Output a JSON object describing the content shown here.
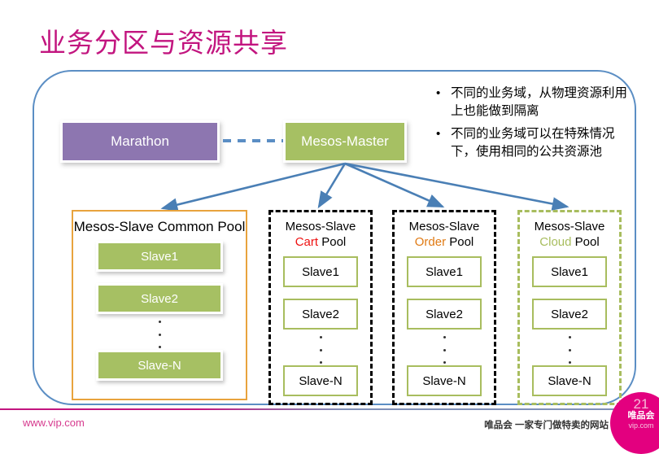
{
  "slide": {
    "title": "业务分区与资源共享"
  },
  "bullets": [
    {
      "marker": "•",
      "text": "不同的业务域，从物理资源利用上也能做到隔离"
    },
    {
      "marker": "•",
      "text": "不同的业务域可以在特殊情况下，使用相同的公共资源池"
    }
  ],
  "top_nodes": {
    "marathon": {
      "label": "Marathon",
      "color": "#8d76b0"
    },
    "mesos_master": {
      "label": "Mesos-Master",
      "color": "#a6c063"
    }
  },
  "pools": [
    {
      "id": "common",
      "title_line1": "Mesos-Slave Common",
      "title_line2": "Pool",
      "tag": "",
      "tag_color": "",
      "border_color": "#e8a33d",
      "border_style": "solid",
      "slave_style": "filled",
      "slaves": [
        "Slave1",
        "Slave2",
        "Slave-N"
      ]
    },
    {
      "id": "cart",
      "title_line1": "Mesos-Slave",
      "title_line2": "Pool",
      "tag": "Cart",
      "tag_color": "#ee1111",
      "border_color": "#000000",
      "border_style": "dashed",
      "slave_style": "outline",
      "slaves": [
        "Slave1",
        "Slave2",
        "Slave-N"
      ]
    },
    {
      "id": "order",
      "title_line1": "Mesos-Slave",
      "title_line2": "Pool",
      "tag": "Order",
      "tag_color": "#e07a14",
      "border_color": "#000000",
      "border_style": "dashed",
      "slave_style": "outline",
      "slaves": [
        "Slave1",
        "Slave2",
        "Slave-N"
      ]
    },
    {
      "id": "cloud",
      "title_line1": "Mesos-Slave",
      "title_line2": "Pool",
      "tag": "Cloud",
      "tag_color": "#a8bd5e",
      "border_color": "#a8bd5e",
      "border_style": "dashed",
      "slave_style": "outline",
      "slaves": [
        "Slave1",
        "Slave2",
        "Slave-N"
      ]
    }
  ],
  "footer": {
    "url": "www.vip.com",
    "tagline": "唯品会 一家专门做特卖的网站",
    "page_number": "21",
    "badge_cn": "唯品会",
    "badge_site": "vip.com"
  },
  "colors": {
    "title": "#c2157f",
    "frame_border": "#5b8ec4",
    "arrow": "#4a7fb5",
    "green": "#a6c063",
    "purple": "#8d76b0",
    "orange": "#e8a33d"
  }
}
